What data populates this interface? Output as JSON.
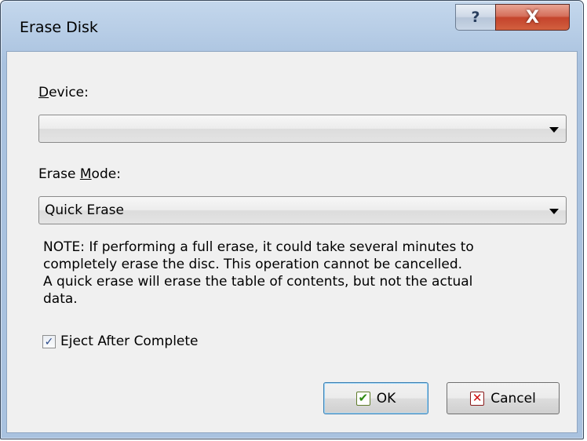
{
  "window": {
    "title": "Erase Disk",
    "help_glyph": "?",
    "close_glyph": "X"
  },
  "device": {
    "label_underlined": "D",
    "label_rest": "evice:",
    "value": ""
  },
  "erase_mode": {
    "label_prefix": "Erase ",
    "label_underlined": "M",
    "label_rest": "ode:",
    "value": "Quick Erase"
  },
  "note_lines": [
    "NOTE: If performing a full erase, it could take several minutes to",
    "completely erase the disc. This operation cannot be cancelled.",
    "A quick erase will erase the table of contents, but not the actual",
    "data."
  ],
  "eject": {
    "label": "Eject After Complete",
    "checked": true,
    "check_glyph": "✓"
  },
  "buttons": {
    "ok_label": "OK",
    "ok_icon": "check-icon",
    "ok_glyph": "✔",
    "cancel_label": "Cancel",
    "cancel_icon": "x-icon",
    "cancel_glyph": "✕"
  }
}
